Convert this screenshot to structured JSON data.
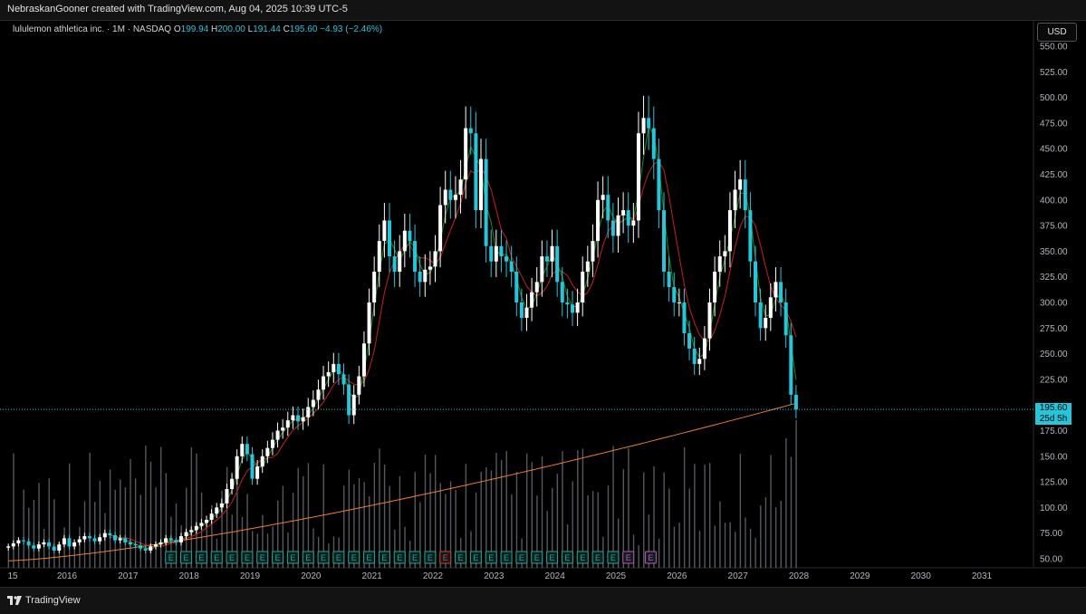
{
  "header": {
    "attribution": "NebraskanGooner created with TradingView.com, Aug 04, 2025 10:39 UTC-5"
  },
  "legend": {
    "symbol": "lululemon athletica inc. · 1M · NASDAQ",
    "o_label": "O",
    "o": "199.94",
    "h_label": "H",
    "h": "200.00",
    "l_label": "L",
    "l": "191.44",
    "c_label": "C",
    "c": "195.60",
    "change": "−4.93 (−2.46%)"
  },
  "currency_button": "USD",
  "last_price": {
    "value": "195.60",
    "countdown": "25d 5h"
  },
  "footer": {
    "brand": "TradingView"
  },
  "colors": {
    "up": "#ffffff",
    "down": "#26c6da",
    "ma_fast": "#1b8a1b",
    "ma_mid": "#c62020",
    "ma_slow": "#f07d2a",
    "volume": "#9aa3ad",
    "earnings": "#26a69a",
    "earnings_miss": "#e53935",
    "earnings_next": "#c850c0"
  },
  "chart_data": {
    "type": "candlestick",
    "timeframe": "1M",
    "y_ticks": [
      50,
      75,
      100,
      125,
      150,
      175,
      200,
      225,
      250,
      275,
      300,
      325,
      350,
      375,
      400,
      425,
      450,
      475,
      500,
      525,
      550
    ],
    "x_ticks": [
      "15",
      "2016",
      "2017",
      "2018",
      "2019",
      "2020",
      "2021",
      "2022",
      "2023",
      "2024",
      "2025",
      "2026",
      "2027",
      "2028",
      "2029",
      "2030",
      "2031"
    ],
    "y_range": [
      45,
      560
    ],
    "last_close": 195.6,
    "candles_start": "2015-01",
    "closes": [
      62,
      65,
      68,
      67,
      63,
      60,
      64,
      66,
      62,
      58,
      64,
      70,
      62,
      66,
      69,
      72,
      70,
      67,
      71,
      75,
      73,
      68,
      70,
      66,
      64,
      63,
      60,
      58,
      62,
      64,
      66,
      70,
      68,
      66,
      72,
      76,
      78,
      82,
      85,
      88,
      94,
      100,
      104,
      118,
      128,
      150,
      162,
      152,
      128,
      140,
      150,
      158,
      166,
      175,
      178,
      185,
      190,
      184,
      188,
      198,
      205,
      215,
      228,
      232,
      240,
      230,
      220,
      190,
      210,
      228,
      260,
      300,
      330,
      360,
      380,
      345,
      330,
      350,
      370,
      360,
      330,
      320,
      332,
      335,
      350,
      395,
      410,
      400,
      405,
      420,
      470,
      465,
      390,
      440,
      355,
      340,
      355,
      345,
      340,
      330,
      300,
      285,
      295,
      310,
      320,
      345,
      340,
      355,
      320,
      300,
      298,
      290,
      300,
      330,
      340,
      360,
      400,
      405,
      380,
      365,
      385,
      390,
      375,
      380,
      465,
      480,
      470,
      440,
      390,
      330,
      315,
      300,
      300,
      270,
      255,
      240,
      245,
      265,
      300,
      330,
      345,
      350,
      390,
      410,
      420,
      390,
      340,
      300,
      275,
      285,
      305,
      320,
      300,
      268,
      210,
      195.6
    ],
    "moving_averages": [
      {
        "name": "fast",
        "period_label": "",
        "values_note": "follows price"
      },
      {
        "name": "mid",
        "period_label": "",
        "values_note": "follows price"
      },
      {
        "name": "slow",
        "period_label": "",
        "values_note": "long-term"
      }
    ],
    "earnings_markers": {
      "label": "E",
      "count": 32
    }
  }
}
